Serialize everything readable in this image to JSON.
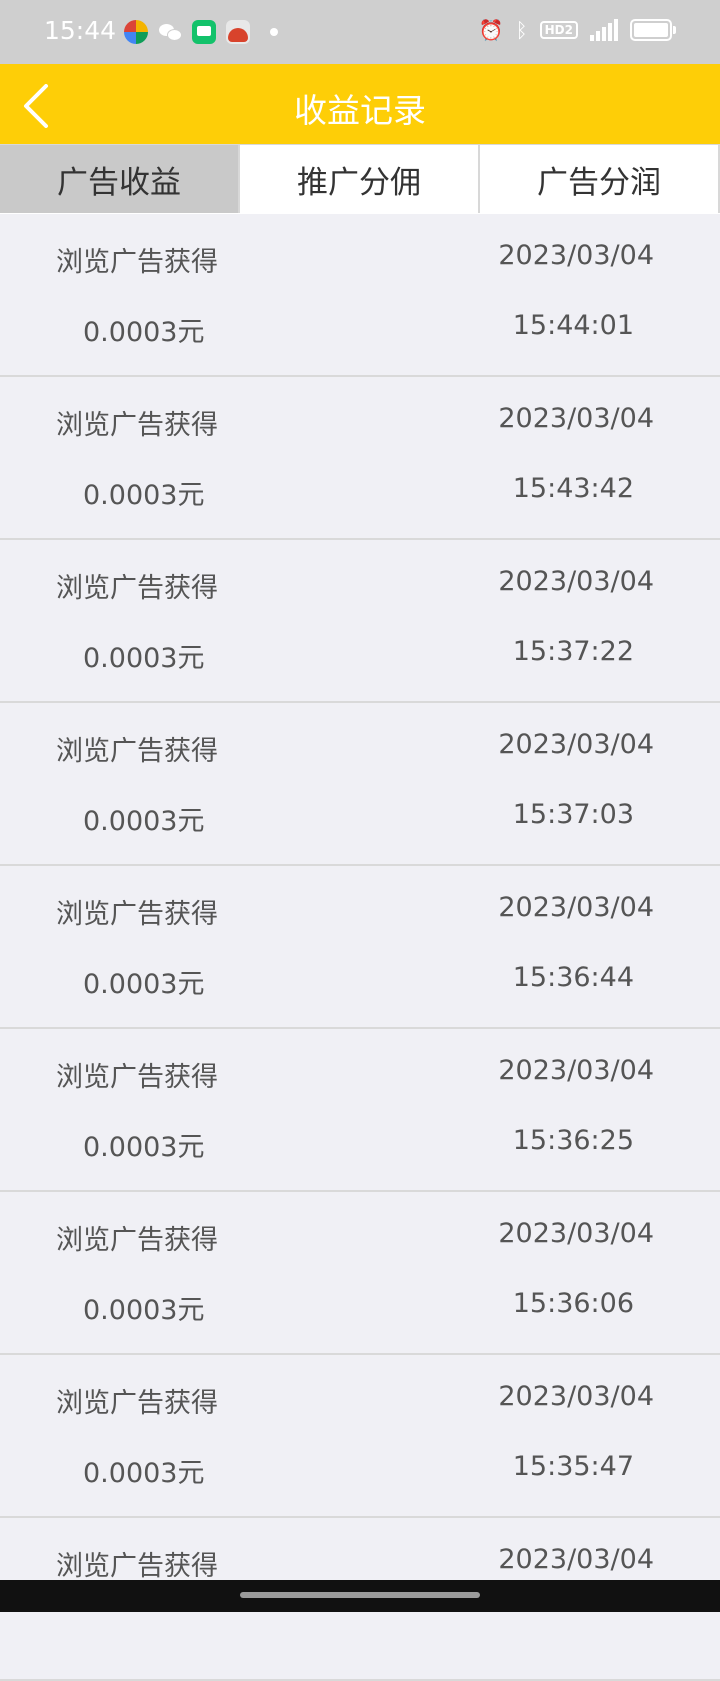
{
  "status_bar": {
    "time": "15:44",
    "icons": [
      "browser-ball-icon",
      "wechat-icon",
      "message-icon",
      "game-icon",
      "dot-icon",
      "alarm-icon",
      "bluetooth-icon",
      "hd-icon",
      "signal-5g-icon",
      "battery-icon"
    ],
    "hd_label": "HD2",
    "network": "5G"
  },
  "header": {
    "title": "收益记录",
    "back_icon": "chevron-left-icon",
    "background_color": "#fece07"
  },
  "tabs": [
    {
      "label": "广告收益",
      "active": true
    },
    {
      "label": "推广分佣",
      "active": false
    },
    {
      "label": "广告分润",
      "active": false
    }
  ],
  "records": [
    {
      "title": "浏览广告获得",
      "amount": "0.0003元",
      "date": "2023/03/04",
      "time": "15:44:01"
    },
    {
      "title": "浏览广告获得",
      "amount": "0.0003元",
      "date": "2023/03/04",
      "time": "15:43:42"
    },
    {
      "title": "浏览广告获得",
      "amount": "0.0003元",
      "date": "2023/03/04",
      "time": "15:37:22"
    },
    {
      "title": "浏览广告获得",
      "amount": "0.0003元",
      "date": "2023/03/04",
      "time": "15:37:03"
    },
    {
      "title": "浏览广告获得",
      "amount": "0.0003元",
      "date": "2023/03/04",
      "time": "15:36:44"
    },
    {
      "title": "浏览广告获得",
      "amount": "0.0003元",
      "date": "2023/03/04",
      "time": "15:36:25"
    },
    {
      "title": "浏览广告获得",
      "amount": "0.0003元",
      "date": "2023/03/04",
      "time": "15:36:06"
    },
    {
      "title": "浏览广告获得",
      "amount": "0.0003元",
      "date": "2023/03/04",
      "time": "15:35:47"
    },
    {
      "title": "浏览广告获得",
      "amount": "",
      "date": "2023/03/04",
      "time": ""
    }
  ]
}
